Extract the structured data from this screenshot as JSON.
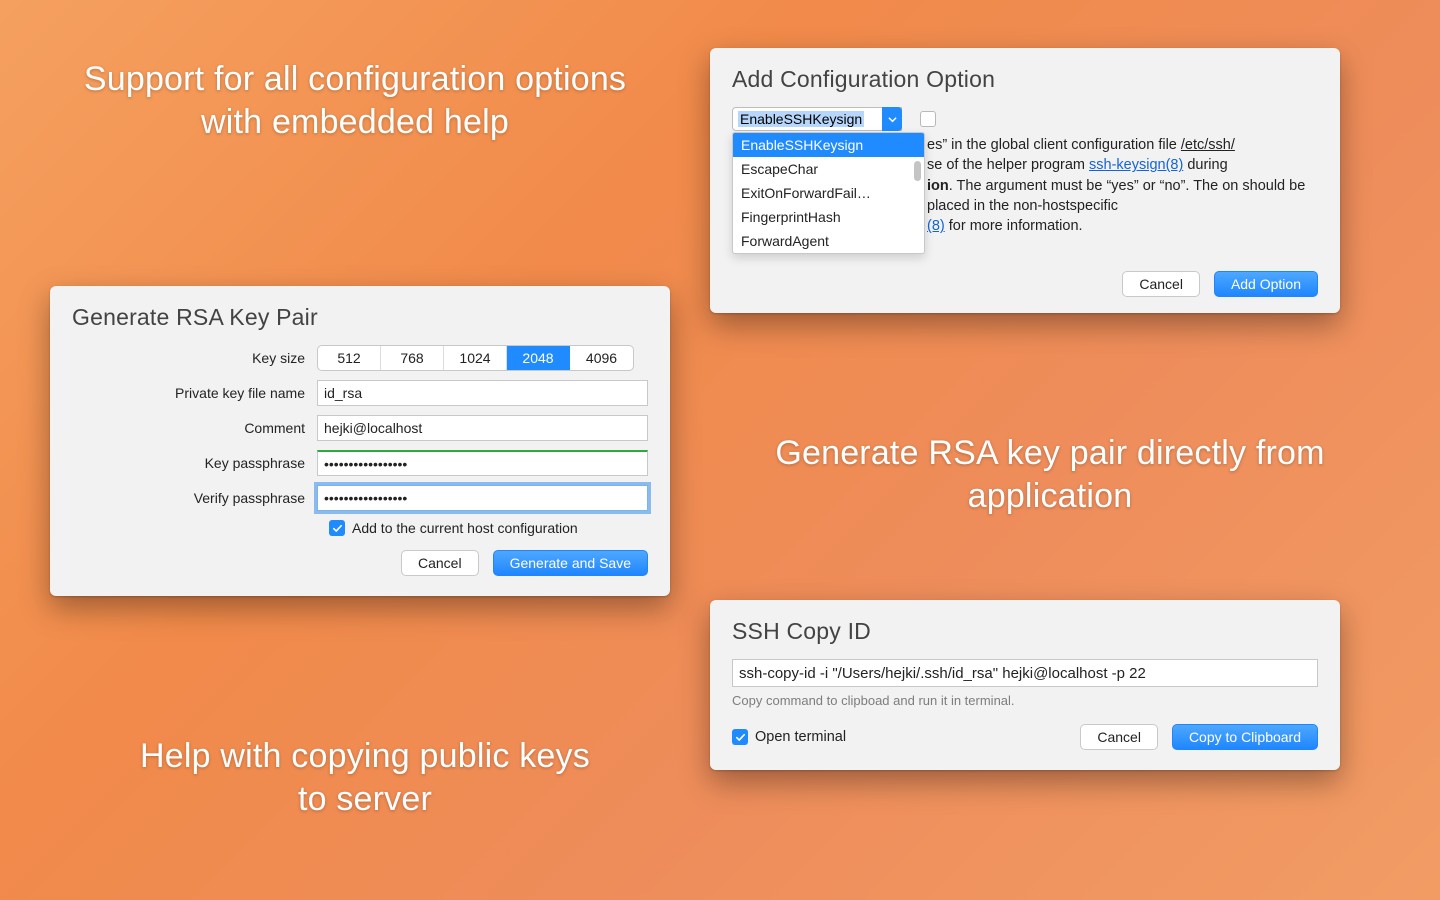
{
  "captions": {
    "topLeft": "Support for all configuration options with embedded help",
    "midRight": "Generate RSA key pair directly from application",
    "bottomLeft": "Help with copying public keys to server"
  },
  "rsa": {
    "title": "Generate RSA Key Pair",
    "labels": {
      "keysize": "Key size",
      "filename": "Private key file name",
      "comment": "Comment",
      "passphrase": "Key passphrase",
      "verify": "Verify passphrase"
    },
    "sizes": [
      "512",
      "768",
      "1024",
      "2048",
      "4096"
    ],
    "selectedSize": "2048",
    "filename": "id_rsa",
    "comment": "hejki@localhost",
    "passphrase": "•••••••••••••••••",
    "verify": "•••••••••••••••••",
    "addToHost": "Add to the current host configuration",
    "cancel": "Cancel",
    "generate": "Generate and Save"
  },
  "cfg": {
    "title": "Add Configuration Option",
    "selected": "EnableSSHKeysign",
    "dropdown": [
      "EnableSSHKeysign",
      "EscapeChar",
      "ExitOnForwardFail…",
      "FingerprintHash",
      "ForwardAgent"
    ],
    "help_pre": "es” in the global client configuration file ",
    "help_file": "/etc/ssh/",
    "help_mid1": "se of the helper program ",
    "help_link1": "ssh-keysign(8)",
    "help_mid2": " during ",
    "help_bold": "ion",
    "help_mid3": ". The argument must be “yes” or “no”. The on should be placed in the non-hostspecific ",
    "help_link2": "(8)",
    "help_tail": " for more information.",
    "cancel": "Cancel",
    "add": "Add Option"
  },
  "copy": {
    "title": "SSH Copy ID",
    "command": "ssh-copy-id -i \"/Users/hejki/.ssh/id_rsa\" hejki@localhost -p 22",
    "hint": "Copy command to clipboad and run it in terminal.",
    "openTerminal": "Open terminal",
    "cancel": "Cancel",
    "copyBtn": "Copy to Clipboard"
  }
}
